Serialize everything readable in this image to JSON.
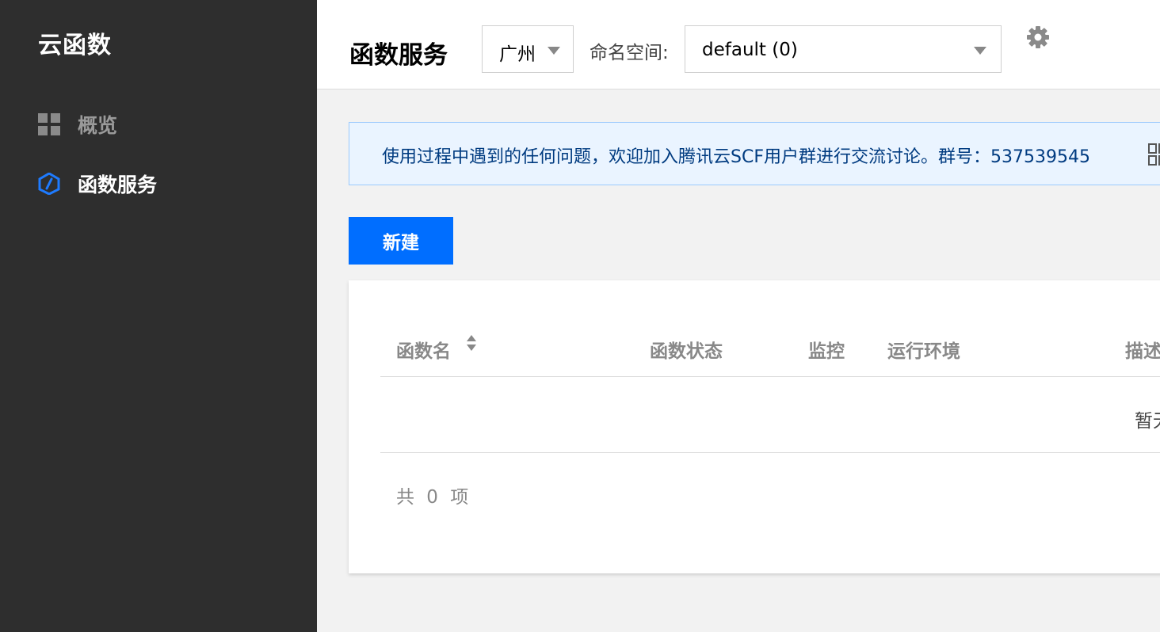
{
  "sidebar": {
    "title": "云函数",
    "items": [
      {
        "label": "概览",
        "icon": "grid-icon"
      },
      {
        "label": "函数服务",
        "icon": "function-hexagon-icon"
      }
    ]
  },
  "header": {
    "title": "函数服务",
    "region": {
      "value": "广州"
    },
    "namespace": {
      "label": "命名空间:",
      "value": "default (0)"
    },
    "settings_icon": "gear-icon"
  },
  "notice": {
    "text": "使用过程中遇到的任何问题，欢迎加入腾讯云SCF用户群进行交流讨论。群号：537539545"
  },
  "toolbar": {
    "new_label": "新建"
  },
  "table": {
    "columns": [
      "函数名",
      "函数状态",
      "监控",
      "运行环境",
      "描述"
    ],
    "empty_text": "暂无",
    "total": "共 0 项"
  },
  "colors": {
    "sidebar_bg": "#2e2e2e",
    "accent": "#006eff",
    "notice_bg": "#eaf4ff",
    "notice_border": "#9ccafc",
    "notice_text": "#003b80"
  }
}
